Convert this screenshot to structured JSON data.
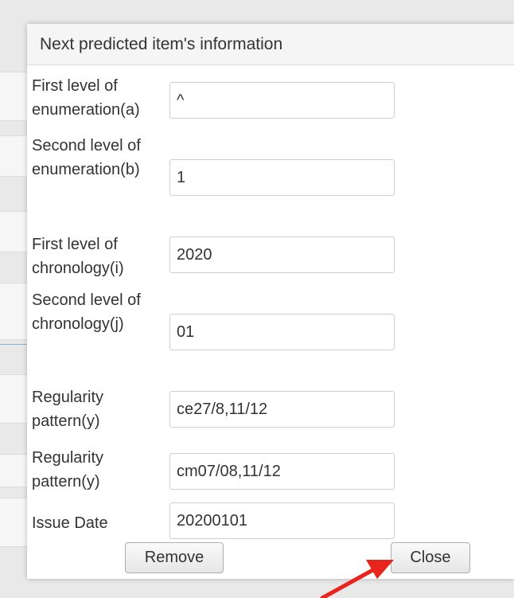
{
  "dialog": {
    "title": "Next predicted item's information",
    "fields": [
      {
        "label": "First level of enumeration(a)",
        "value": "^"
      },
      {
        "label": "Second level of enumeration(b)",
        "value": "1"
      },
      {
        "label": "First level of chronology(i)",
        "value": "2020"
      },
      {
        "label": "Second level of chronology(j)",
        "value": "01"
      },
      {
        "label": "Regularity pattern(y)",
        "value": "ce27/8,11/12"
      },
      {
        "label": "Regularity pattern(y)",
        "value": "cm07/08,11/12"
      },
      {
        "label": "Issue Date",
        "value": "20200101"
      }
    ],
    "buttons": {
      "remove": "Remove",
      "close": "Close"
    }
  },
  "annotation": {
    "arrow_color": "#e8241c"
  }
}
